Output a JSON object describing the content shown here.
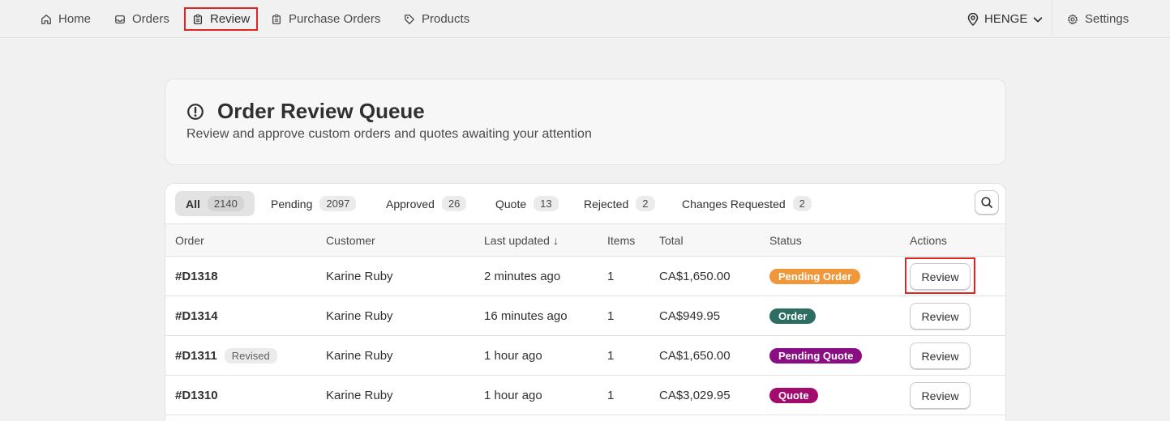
{
  "nav": {
    "items": [
      {
        "label": "Home",
        "icon": "home-icon"
      },
      {
        "label": "Orders",
        "icon": "inbox-icon"
      },
      {
        "label": "Review",
        "icon": "clipboard-icon",
        "highlighted": true
      },
      {
        "label": "Purchase Orders",
        "icon": "clipboard-list-icon"
      },
      {
        "label": "Products",
        "icon": "tag-icon"
      }
    ],
    "store_name": "HENGE",
    "settings_label": "Settings"
  },
  "header": {
    "title": "Order Review Queue",
    "subtitle": "Review and approve custom orders and quotes awaiting your attention"
  },
  "tabs": [
    {
      "label": "All",
      "count": "2140",
      "active": true
    },
    {
      "label": "Pending",
      "count": "2097"
    },
    {
      "label": "Approved",
      "count": "26"
    },
    {
      "label": "Quote",
      "count": "13"
    },
    {
      "label": "Rejected",
      "count": "2"
    },
    {
      "label": "Changes Requested",
      "count": "2"
    }
  ],
  "table": {
    "columns": [
      "Order",
      "Customer",
      "Last updated",
      "Items",
      "Total",
      "Status",
      "Actions"
    ],
    "sort_indicator": "↓",
    "rows": [
      {
        "order": "#D1318",
        "revised": "",
        "customer": "Karine Ruby",
        "updated": "2 minutes ago",
        "items": "1",
        "total": "CA$1,650.00",
        "status": "Pending Order",
        "action": "Review"
      },
      {
        "order": "#D1314",
        "revised": "",
        "customer": "Karine Ruby",
        "updated": "16 minutes ago",
        "items": "1",
        "total": "CA$949.95",
        "status": "Order",
        "action": "Review"
      },
      {
        "order": "#D1311",
        "revised": "Revised",
        "customer": "Karine Ruby",
        "updated": "1 hour ago",
        "items": "1",
        "total": "CA$1,650.00",
        "status": "Pending Quote",
        "action": "Review"
      },
      {
        "order": "#D1310",
        "revised": "",
        "customer": "Karine Ruby",
        "updated": "1 hour ago",
        "items": "1",
        "total": "CA$3,029.95",
        "status": "Quote",
        "action": "Review"
      }
    ]
  },
  "colors": {
    "highlight": "#e02424",
    "pending_order": "#f0973a",
    "order": "#2d6d62",
    "pending_quote": "#8a0d84",
    "quote": "#a30b6e"
  }
}
